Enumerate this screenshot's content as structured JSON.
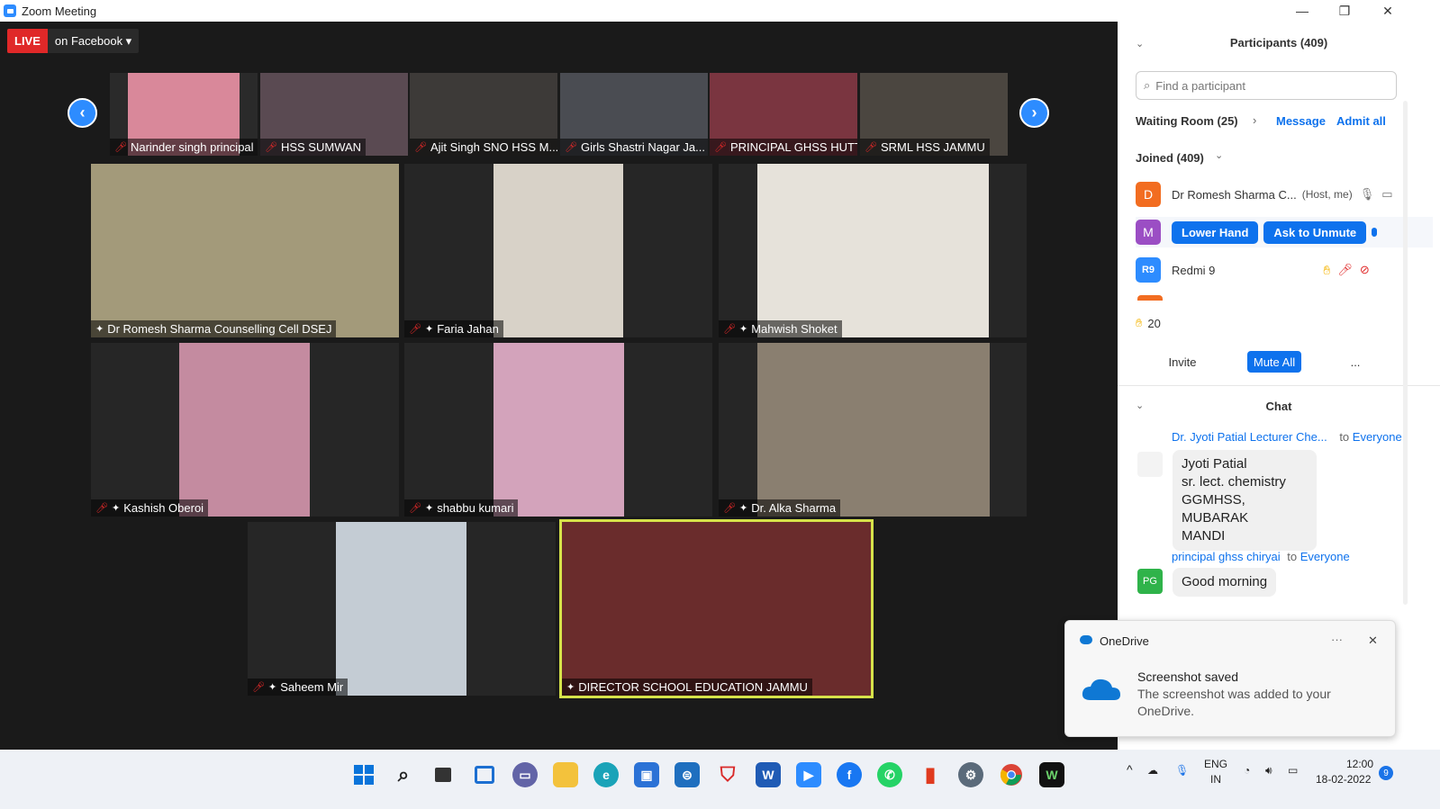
{
  "window": {
    "title": "Zoom Meeting",
    "minimize": "—",
    "restore": "❐",
    "close": "✕"
  },
  "live": {
    "badge": "LIVE",
    "destination": "on Facebook ▾"
  },
  "strip": [
    {
      "name": "Narinder singh principal",
      "bg": "#d9889a"
    },
    {
      "name": "HSS SUMWAN",
      "bg": "#5a4a52"
    },
    {
      "name": "Ajit Singh SNO HSS M...",
      "bg": "#3d3a38"
    },
    {
      "name": "Girls Shastri Nagar Ja...",
      "bg": "#4a4c52"
    },
    {
      "name": "PRINCIPAL GHSS HUTT",
      "bg": "#7a3540"
    },
    {
      "name": "SRML HSS JAMMU",
      "bg": "#4b4640"
    }
  ],
  "grid": [
    {
      "name": "Dr Romesh Sharma Counselling Cell DSEJ",
      "bg": "#a39a7a",
      "mic_off": false
    },
    {
      "name": "Faria Jahan",
      "bg": "#d8d2c8",
      "mic_off": true
    },
    {
      "name": "Mahwish Shoket",
      "bg": "#e6e2da",
      "mic_off": true
    },
    {
      "name": "Kashish Oberoi",
      "bg": "#c48ba0",
      "mic_off": true
    },
    {
      "name": "shabbu kumari",
      "bg": "#d3a3bb",
      "mic_off": true
    },
    {
      "name": "Dr. Alka Sharma",
      "bg": "#8a7f70",
      "mic_off": true
    },
    {
      "name": "Saheem Mir",
      "bg": "#c4ccd4",
      "mic_off": true
    },
    {
      "name": "DIRECTOR SCHOOL EDUCATION JAMMU",
      "bg": "#6a2c2c",
      "mic_off": false
    }
  ],
  "participants": {
    "header": "Participants (409)",
    "search_placeholder": "Find a participant",
    "waiting_room": "Waiting Room (25)",
    "message": "Message",
    "admit_all": "Admit all",
    "joined": "Joined (409)",
    "rows": [
      {
        "initial": "D",
        "color": "#f26d21",
        "name": "Dr Romesh Sharma C...",
        "role": "(Host, me)"
      },
      {
        "initial": "M",
        "color": "#9b4ec4",
        "lower_hand": "Lower Hand",
        "ask_unmute": "Ask to Unmute"
      },
      {
        "initial": "R9",
        "color": "#2d8cff",
        "name": "Redmi 9"
      }
    ],
    "raised_hands": "20",
    "invite": "Invite",
    "mute_all": "Mute All",
    "more": "..."
  },
  "chat": {
    "header": "Chat",
    "messages": [
      {
        "sender": "Dr. Jyoti Patial Lecturer Che...",
        "to": "to",
        "recipient": "Everyone",
        "lines": [
          "Jyoti Patial",
          "sr. lect. chemistry",
          "GGMHSS, MUBARAK",
          "MANDI"
        ]
      },
      {
        "sender": "principal ghss  chiryai",
        "to": "to",
        "recipient": "Everyone",
        "initials": "PG",
        "text": "Good morning"
      }
    ]
  },
  "toast": {
    "app": "OneDrive",
    "title": "Screenshot saved",
    "line1": "The screenshot was added to your",
    "line2": "OneDrive.",
    "dots": "···",
    "close": "✕"
  },
  "taskbar": {
    "lang": "ENG",
    "region": "IN",
    "time": "12:00",
    "date": "18-02-2022",
    "badge": "9",
    "chevron": "^"
  }
}
